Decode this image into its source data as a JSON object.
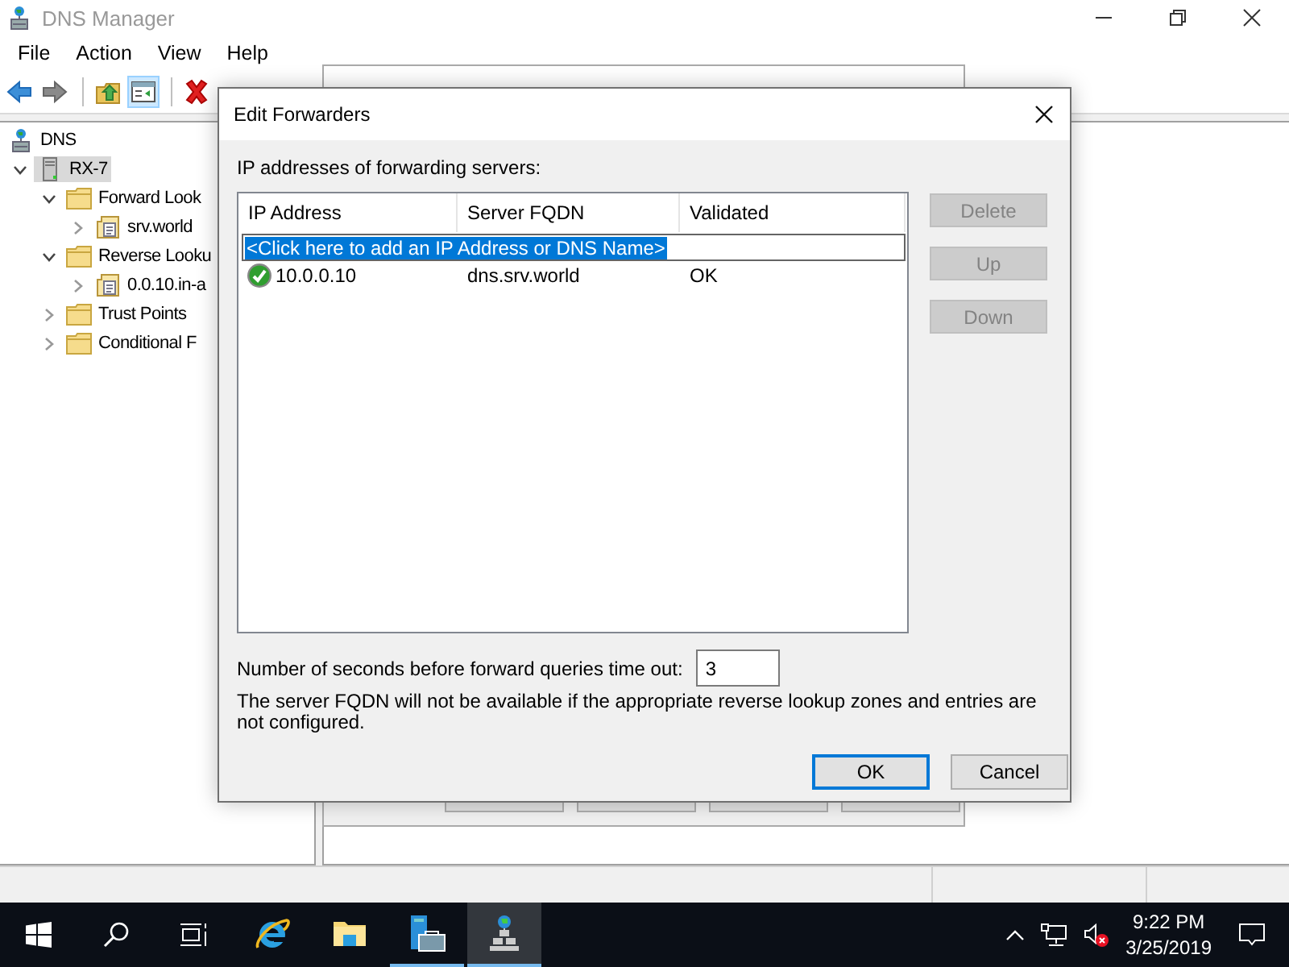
{
  "window": {
    "title": "DNS Manager"
  },
  "menu": [
    {
      "label": "File"
    },
    {
      "label": "Action"
    },
    {
      "label": "View"
    },
    {
      "label": "Help"
    }
  ],
  "toolbar": [
    [
      {
        "kind": "back",
        "pressed": false
      },
      {
        "kind": "forward",
        "pressed": false
      }
    ],
    [
      {
        "kind": "up",
        "pressed": false
      },
      {
        "kind": "console-tree",
        "pressed": true
      }
    ],
    [
      {
        "kind": "delete",
        "pressed": false
      }
    ]
  ],
  "tree": [
    {
      "label": "DNS",
      "kind": "dns",
      "selected": false,
      "children": [
        {
          "label": "RX-7",
          "kind": "server",
          "selected": true,
          "expanded": true,
          "children": [
            {
              "label": "Forward Look",
              "kind": "folder",
              "selected": false,
              "expanded": true,
              "children": [
                {
                  "label": "srv.world",
                  "kind": "zone",
                  "selected": false,
                  "expanded": false
                }
              ]
            },
            {
              "label": "Reverse Looku",
              "kind": "folder",
              "selected": false,
              "expanded": true,
              "children": [
                {
                  "label": "0.0.10.in-a",
                  "kind": "zone",
                  "selected": false,
                  "expanded": false
                }
              ]
            },
            {
              "label": "Trust Points",
              "kind": "folder",
              "selected": false,
              "expanded": false
            },
            {
              "label": "Conditional F",
              "kind": "folder",
              "selected": false,
              "expanded": false
            }
          ]
        }
      ]
    }
  ],
  "dialog": {
    "title": "Edit Forwarders",
    "list_label": "IP addresses of forwarding servers:",
    "columns": [
      "IP Address",
      "Server FQDN",
      "Validated"
    ],
    "add_row": {
      "value": "<Click here to add an IP Address or DNS Name>",
      "highlighted": true
    },
    "rows": [
      {
        "ip": "10.0.0.10",
        "fqdn": "dns.srv.world",
        "validated": "OK",
        "valid": true
      }
    ],
    "side_buttons": [
      {
        "label": "Delete",
        "disabled": true
      },
      {
        "label": "Up",
        "disabled": true
      },
      {
        "label": "Down",
        "disabled": true
      }
    ],
    "timeout_label": "Number of seconds before forward queries time out:",
    "timeout_value": "3",
    "note": "The server FQDN will not be available if the appropriate reverse lookup zones and entries are not configured.",
    "buttons": [
      {
        "label": "OK",
        "default": true
      },
      {
        "label": "Cancel",
        "default": false
      }
    ]
  },
  "taskbar": {
    "buttons": [
      {
        "kind": "start"
      },
      {
        "kind": "search"
      },
      {
        "kind": "task-view"
      }
    ],
    "apps": [
      {
        "kind": "browser",
        "running": false,
        "active": false
      },
      {
        "kind": "explorer",
        "running": false,
        "active": false
      },
      {
        "kind": "server-manager",
        "running": true,
        "active": false
      },
      {
        "kind": "dns",
        "running": true,
        "active": true
      }
    ],
    "tray": {
      "volume_muted": true
    },
    "clock": {
      "time": "9:22 PM",
      "date": "3/25/2019"
    }
  }
}
